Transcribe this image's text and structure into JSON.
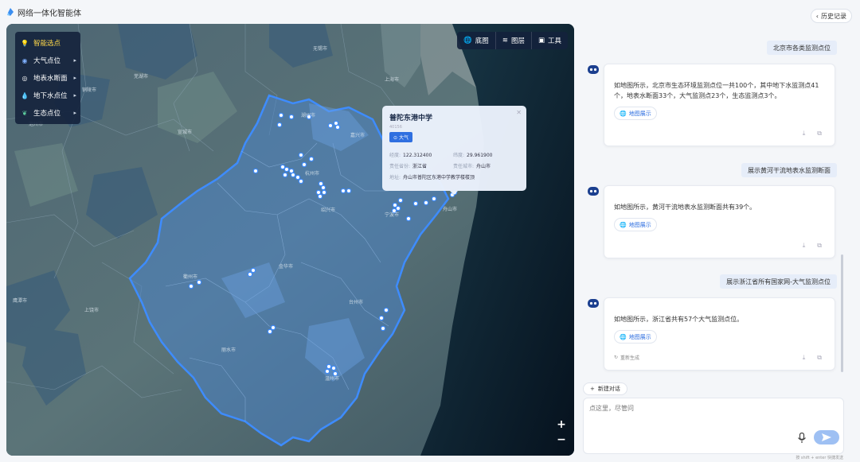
{
  "app": {
    "title": "网络一体化智能体",
    "history_label": "历史记录"
  },
  "map": {
    "layers": [
      {
        "label": "智能选点",
        "icon": "bulb-icon",
        "active": true,
        "has_arrow": false
      },
      {
        "label": "大气点位",
        "icon": "dot-icon",
        "active": false,
        "has_arrow": true
      },
      {
        "label": "地表水断面",
        "icon": "water-section-icon",
        "active": false,
        "has_arrow": true
      },
      {
        "label": "地下水点位",
        "icon": "drop-icon",
        "active": false,
        "has_arrow": true
      },
      {
        "label": "生态点位",
        "icon": "leaf-icon",
        "active": false,
        "has_arrow": true
      }
    ],
    "tools": [
      {
        "label": "底图",
        "icon": "globe-icon"
      },
      {
        "label": "图层",
        "icon": "layers-icon"
      },
      {
        "label": "工具",
        "icon": "toolbox-icon"
      }
    ],
    "zoom_in": "+",
    "zoom_out": "−",
    "place_labels": [
      "上海市",
      "湖州市",
      "嘉兴市",
      "杭州市",
      "宁波市",
      "绍兴市",
      "舟山市",
      "金华市",
      "台州市",
      "衢州市",
      "丽水市",
      "温州市",
      "宣城市",
      "无锡市",
      "上饶市",
      "鹰潭市",
      "芜湖市",
      "铜陵市",
      "池州市"
    ],
    "popup": {
      "title": "普陀东港中学",
      "code": "40156",
      "tag": "大气",
      "lng_label": "经度:",
      "lng_value": "122.312400",
      "lat_label": "纬度:",
      "lat_value": "29.961900",
      "province_label": "责任省份:",
      "province_value": "浙江省",
      "city_label": "责任城市:",
      "city_value": "舟山市",
      "address_label": "地址:",
      "address_value": "舟山市普陀区东港中学教学楼楼顶"
    }
  },
  "chat": {
    "messages": [
      {
        "role": "user",
        "text": "北京市各类监测点位"
      },
      {
        "role": "ai",
        "text": "如地图所示，北京市生态环境监测点位一共100个，其中地下水监测点41个，地表水断面33个，大气监测点23个，生态监测点3个。",
        "map_link": "地图展示"
      },
      {
        "role": "user",
        "text": "展示黄河干流地表水监测断面"
      },
      {
        "role": "ai",
        "text": "如地图所示，黄河干流地表水监测断面共有39个。",
        "map_link": "地图展示"
      },
      {
        "role": "user",
        "text": "展示浙江省所有国家网-大气监测点位"
      },
      {
        "role": "ai",
        "text": "如地图所示，浙江省共有57个大气监测点位。",
        "map_link": "地图展示",
        "regen": "重新生成"
      }
    ],
    "new_chat_label": "新建对话",
    "input_placeholder": "点这里，尽管问",
    "hint": "按 shift + enter 快捷发送"
  },
  "colors": {
    "accent": "#2f6fe0",
    "province_fill": "#4a86d0",
    "popup_bg": "#ebf2fc",
    "sea": "#0c1c2e"
  }
}
